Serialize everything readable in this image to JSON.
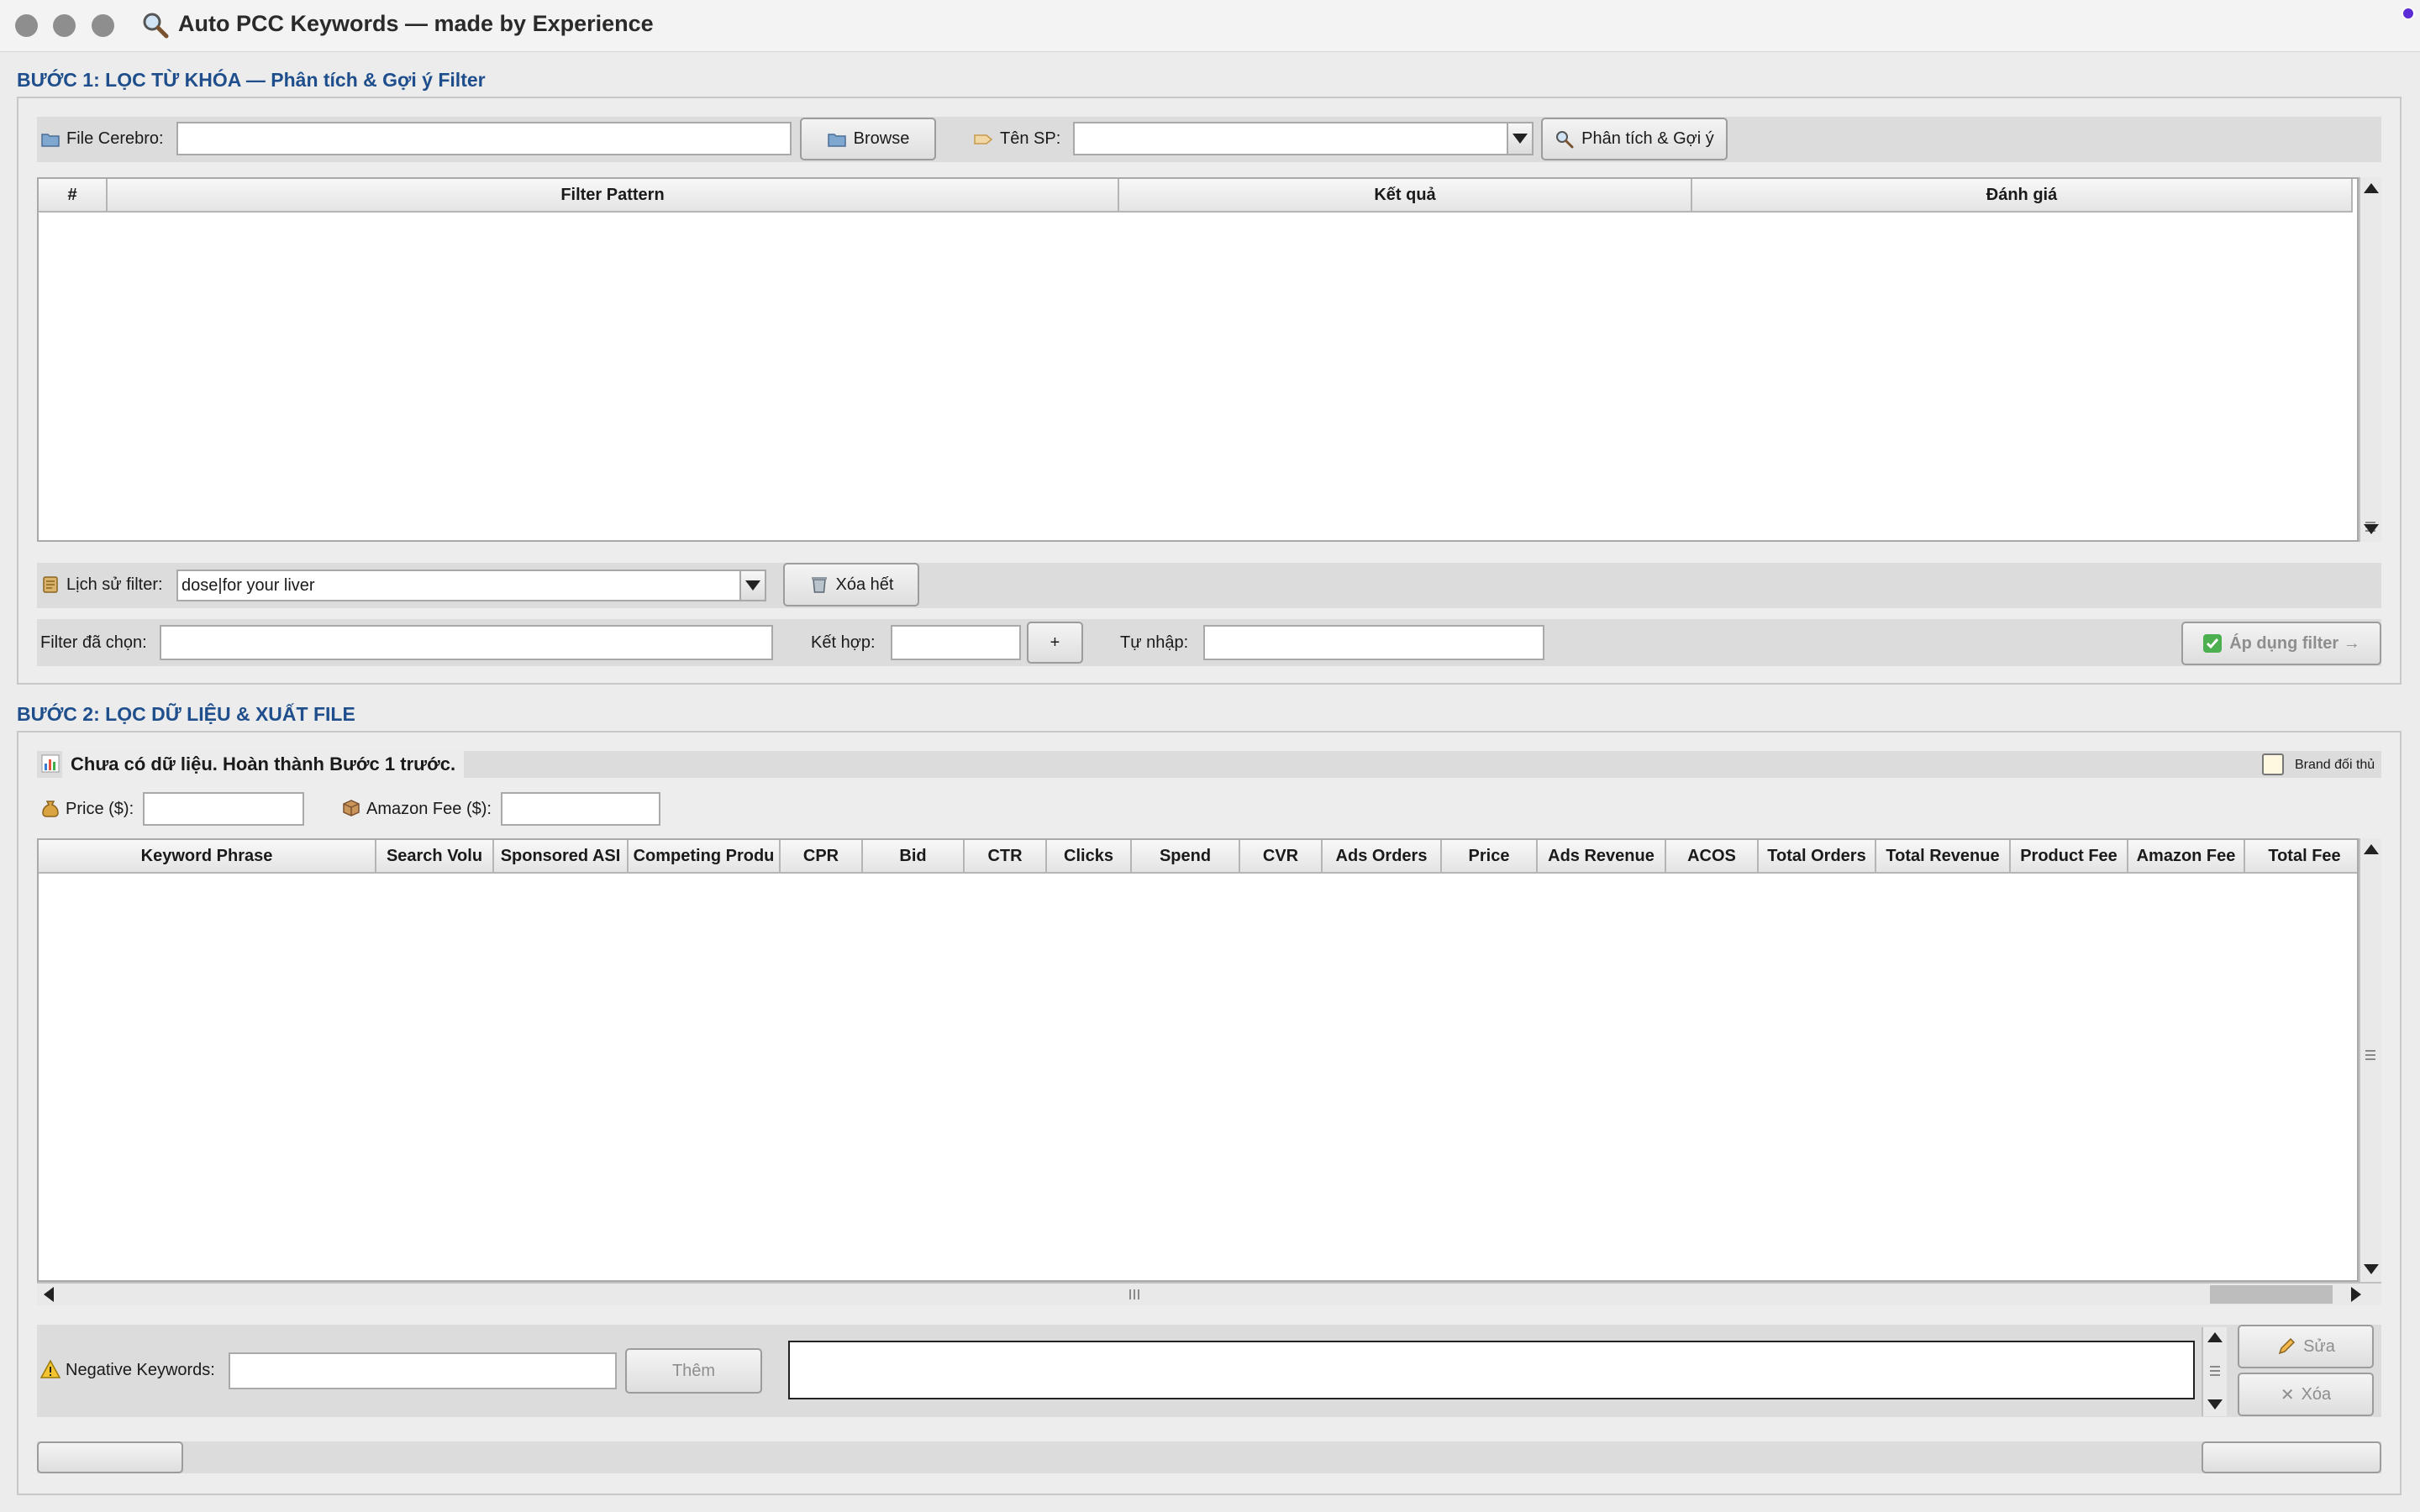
{
  "window": {
    "title": "Auto PCC Keywords — made by Experience",
    "accent": "#1f4e8c"
  },
  "step1": {
    "title": "BƯỚC 1: LỌC TỪ KHÓA — Phân tích & Gợi ý Filter",
    "file_label": "File Cerebro:",
    "file_value": "",
    "browse_label": "Browse",
    "product_label": "Tên SP:",
    "product_value": "",
    "analyze_label": "Phân tích & Gợi ý",
    "table_headers": [
      "#",
      "Filter Pattern",
      "Kết quả",
      "Đánh giá"
    ],
    "history_label": "Lịch sử filter:",
    "history_value": "dose|for your liver",
    "clear_label": "Xóa hết",
    "selected_label": "Filter đã chọn:",
    "selected_value": "",
    "combine_label": "Kết hợp:",
    "combine_value": "",
    "plus_label": "+",
    "manual_label": "Tự nhập:",
    "manual_value": "",
    "apply_label": "Áp dụng filter →"
  },
  "step2": {
    "title": "BƯỚC 2: LỌC DỮ LIỆU & XUẤT FILE",
    "status_text": "Chưa có dữ liệu. Hoàn thành Bước 1 trước.",
    "brand_label": "Brand đối thủ",
    "brand_checked": false,
    "price_label": "Price ($):",
    "price_value": "",
    "fee_label": "Amazon Fee ($):",
    "fee_value": "",
    "table_headers": [
      "Keyword Phrase",
      "Search Volu",
      "Sponsored ASI",
      "Competing Produ",
      "CPR",
      "Bid",
      "CTR",
      "Clicks",
      "Spend",
      "CVR",
      "Ads Orders",
      "Price",
      "Ads Revenue",
      "ACOS",
      "Total Orders",
      "Total Revenue",
      "Product Fee",
      "Amazon Fee",
      "Total Fee"
    ],
    "negative_label": "Negative Keywords:",
    "negative_value": "",
    "add_label": "Thêm",
    "edit_label": "Sửa",
    "delete_label": "Xóa"
  }
}
